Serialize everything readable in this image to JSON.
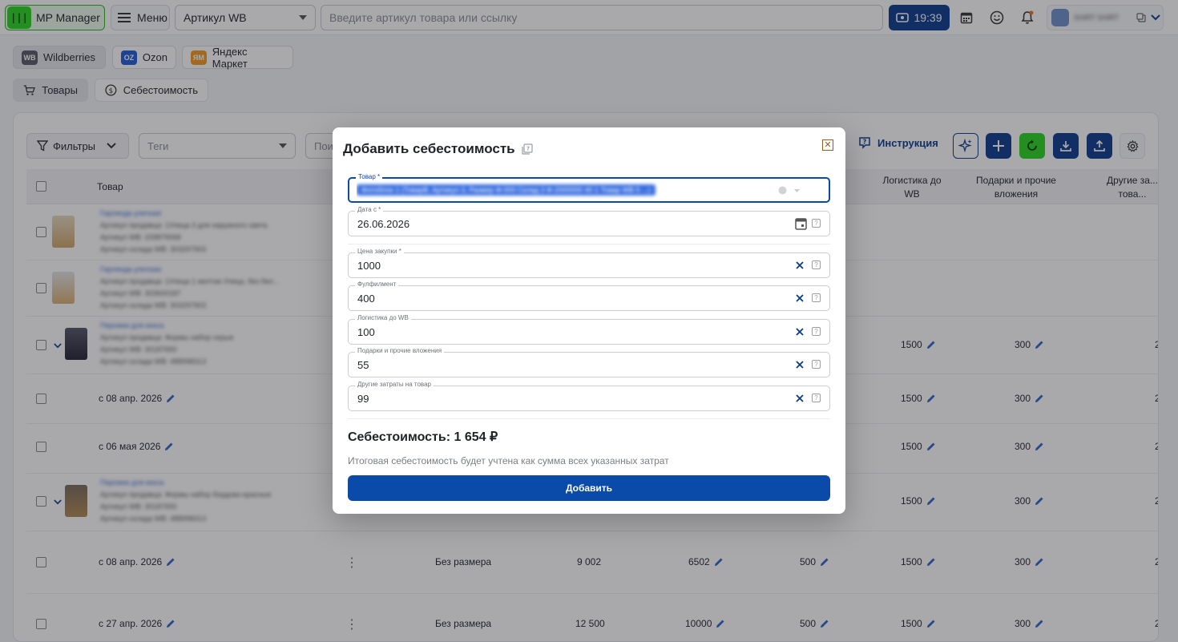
{
  "header": {
    "logo_text": "MP Manager",
    "logo_mark": "|||",
    "menu_label": "Меню",
    "article_select": "Артикул WB",
    "search_placeholder": "Введите артикул товара или ссылку",
    "timer": "19:39",
    "user_name": "SHIRT SHIRT"
  },
  "marketplaces": [
    {
      "badge": "WB",
      "label": "Wildberries",
      "color": "#5a5a66"
    },
    {
      "badge": "OZ",
      "label": "Ozon",
      "color": "#1e5bd8"
    },
    {
      "badge": "ЯМ",
      "label": "Яндекс Маркет",
      "color": "#f39a1e"
    }
  ],
  "tabs": [
    {
      "label": "Товары"
    },
    {
      "label": "Себестоимость"
    }
  ],
  "toolbar": {
    "filters_label": "Фильтры",
    "tags_placeholder": "Теги",
    "search_partial": "Пои",
    "instruction_label": "Инструкция"
  },
  "table": {
    "headers": {
      "product": "Товар",
      "logistics": "Логистика до WB",
      "gifts": "Подарки и прочие вложения",
      "other": "Другие за... това..."
    },
    "rows": [
      {
        "kind": "product",
        "name": "Гирлянда уличная",
        "line1": "Артикул продавца: 1Улица 3 для наружного света",
        "line2": "Артикул WB: 209879068",
        "line3": "Артикул склада WB: 303297903"
      },
      {
        "kind": "product",
        "name": "Гирлянда уличная",
        "line1": "Артикул продавца: 1Улица 1 желтая Улица, без бел...",
        "line2": "Артикул WB: 303600187",
        "line3": "Артикул склада WB: 303297903"
      },
      {
        "kind": "product-exp",
        "name": "Пирожки для кекса",
        "line1": "Артикул продавца: Формы набор серые",
        "line2": "Артикул WB: 30187650",
        "line3": "Артикул склада WB: 488998313",
        "logistics": "1500",
        "gifts": "300",
        "other": "2"
      },
      {
        "kind": "date",
        "date": "с 08 апр. 2026",
        "logistics": "1500",
        "gifts": "300",
        "other": "2"
      },
      {
        "kind": "date",
        "date": "с 06 мая 2026",
        "logistics": "1500",
        "gifts": "300",
        "other": "2"
      },
      {
        "kind": "product-exp",
        "name": "Пирожки для кекса",
        "line1": "Артикул продавца: Формы набор бордово-красные",
        "line2": "Артикул WB: 30187650",
        "line3": "Артикул склада WB: 488998313",
        "logistics": "1500",
        "gifts": "300",
        "other": "2"
      },
      {
        "kind": "date-full",
        "date": "с 08 апр. 2026",
        "size": "Без размера",
        "barcode": "9 002",
        "purchase": "6502",
        "fulfillment": "500",
        "logistics": "1500",
        "gifts": "300",
        "other": "2"
      },
      {
        "kind": "date-full",
        "date": "с 27 апр. 2026",
        "size": "Без размера",
        "barcode": "12 500",
        "purchase": "10000",
        "fulfillment": "500",
        "logistics": "1500",
        "gifts": "300",
        "other": "2"
      }
    ]
  },
  "modal": {
    "title": "Добавить себестоимость",
    "product_label": "Товар *",
    "product_value": "Фотоблок 1 (ТоварВ, Артикул 3, Размер Ф-000 Склад 3 Ф-2000000 40 1 Товар WB 5 ...)",
    "date_label": "Дата с *",
    "date_value": "26.06.2026",
    "fields": [
      {
        "label": "Цена закупки *",
        "value": "1000"
      },
      {
        "label": "Фулфилмент",
        "value": "400"
      },
      {
        "label": "Логистика до WB",
        "value": "100"
      },
      {
        "label": "Подарки и прочие вложения",
        "value": "55"
      },
      {
        "label": "Другие затраты на товар",
        "value": "99"
      }
    ],
    "total": "Себестоимость: 1 654 ₽",
    "note": "Итоговая себестоимость будет учтена как сумма всех указанных затрат",
    "submit_label": "Добавить"
  },
  "colors": {
    "primary": "#0a4aa8",
    "dark_primary": "#0a3a8c",
    "accent_green": "#2bd420"
  }
}
